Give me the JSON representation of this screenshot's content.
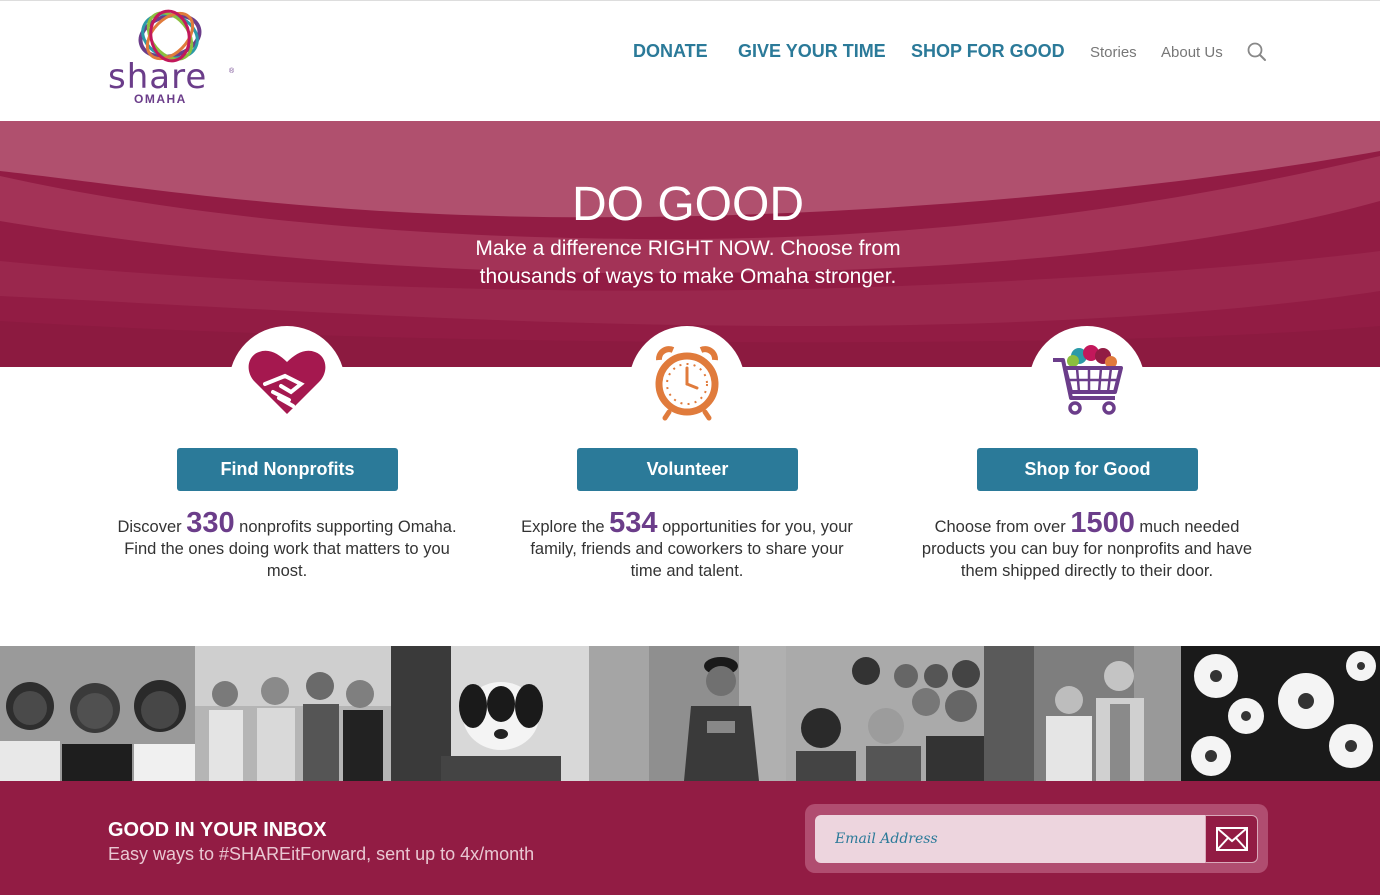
{
  "header": {
    "logo_text": "share",
    "logo_sub": "OMAHA",
    "nav_main": [
      "DONATE",
      "GIVE YOUR TIME",
      "SHOP FOR GOOD"
    ],
    "nav_sub": [
      "Stories",
      "About Us"
    ],
    "search_icon": "search-icon"
  },
  "hero": {
    "title": "DO GOOD",
    "subtitle": "Make a difference RIGHT NOW. Choose from thousands of ways to make Omaha stronger."
  },
  "features": [
    {
      "icon": "heart-handshake-icon",
      "button": "Find Nonprofits",
      "pre": "Discover ",
      "number": "330",
      "post": " nonprofits supporting Omaha. Find the ones doing work that matters to you most."
    },
    {
      "icon": "alarm-clock-icon",
      "button": "Volunteer",
      "pre": "Explore the ",
      "number": "534",
      "post": " opportunities for you, your family, friends and coworkers to share your time and talent."
    },
    {
      "icon": "shopping-cart-icon",
      "button": "Shop for Good",
      "pre": "Choose from over ",
      "number": "1500",
      "post": " much needed products you can buy for nonprofits and have them shipped directly to their door."
    }
  ],
  "footer": {
    "title": "GOOD IN YOUR INBOX",
    "subtitle": "Easy ways to #SHAREitForward, sent up to 4x/month",
    "email_placeholder": "Email Address"
  },
  "colors": {
    "brand_crimson": "#921c44",
    "brand_teal": "#2b7a99",
    "brand_purple": "#6b3d8a",
    "clock_orange": "#e07b3c"
  }
}
